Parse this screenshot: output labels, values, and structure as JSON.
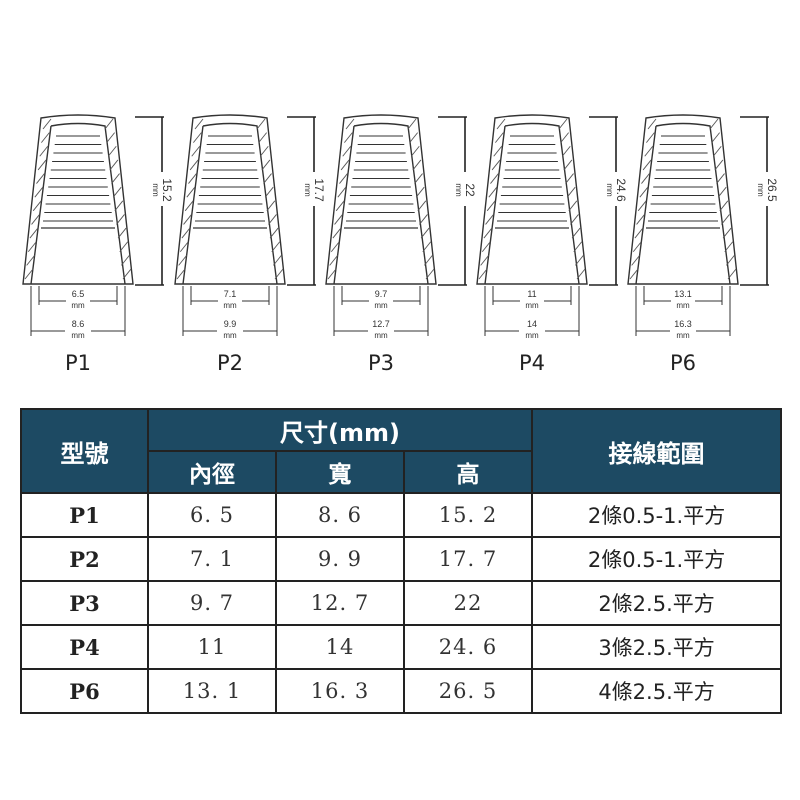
{
  "caps": [
    {
      "label": "P1",
      "height": "15.2",
      "inner": "6.5",
      "width": "8.6"
    },
    {
      "label": "P2",
      "height": "17.7",
      "inner": "7.1",
      "width": "9.9"
    },
    {
      "label": "P3",
      "height": "22",
      "inner": "9.7",
      "width": "12.7"
    },
    {
      "label": "P4",
      "height": "24.6",
      "inner": "11",
      "width": "14"
    },
    {
      "label": "P6",
      "height": "26.5",
      "inner": "13.1",
      "width": "16.3"
    }
  ],
  "unit": "mm",
  "table": {
    "col_model": "型號",
    "col_size": "尺寸(mm)",
    "col_range": "接線範圍",
    "sub_inner": "內徑",
    "sub_width": "寬",
    "sub_height": "高",
    "rows": [
      {
        "model": "P1",
        "inner": "6. 5",
        "width": "8. 6",
        "height": "15. 2",
        "range": "2條0.5-1.平方"
      },
      {
        "model": "P2",
        "inner": "7. 1",
        "width": "9. 9",
        "height": "17. 7",
        "range": "2條0.5-1.平方"
      },
      {
        "model": "P3",
        "inner": "9. 7",
        "width": "12. 7",
        "height": "22",
        "range": "2條2.5.平方"
      },
      {
        "model": "P4",
        "inner": "11",
        "width": "14",
        "height": "24. 6",
        "range": "3條2.5.平方"
      },
      {
        "model": "P6",
        "inner": "13. 1",
        "width": "16. 3",
        "height": "26. 5",
        "range": "4條2.5.平方"
      }
    ]
  }
}
